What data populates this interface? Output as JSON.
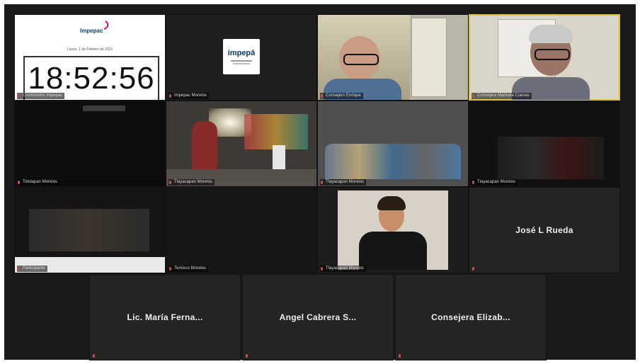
{
  "meeting": {
    "clock_tile": {
      "org_name": "Impepac",
      "date_line": "Lunes, 1 de Febrero de 2021",
      "time": "18:52:56",
      "label": "Cronómetro Impepac"
    },
    "logo_tile": {
      "logo_text": "impepā",
      "label": "Impepac Morelos"
    },
    "video_tiles": [
      {
        "label": "Consejero Enrique"
      },
      {
        "label": "Consejera Marisela Cuevas"
      },
      {
        "label": "Totolapan Morelos"
      },
      {
        "label": "Tlayacapan Morelos"
      },
      {
        "label": "Tlayacapan Morelos"
      },
      {
        "label": "Tlayacapan Morelos"
      },
      {
        "label": "Participante"
      },
      {
        "label": "Temixco Morelos"
      },
      {
        "label": "Tlayacapan Morelos"
      }
    ],
    "name_tiles": [
      {
        "name": "José L Rueda"
      },
      {
        "name": "Lic. María Ferna..."
      },
      {
        "name": "Angel Cabrera S..."
      },
      {
        "name": "Consejera Elizab..."
      }
    ]
  }
}
